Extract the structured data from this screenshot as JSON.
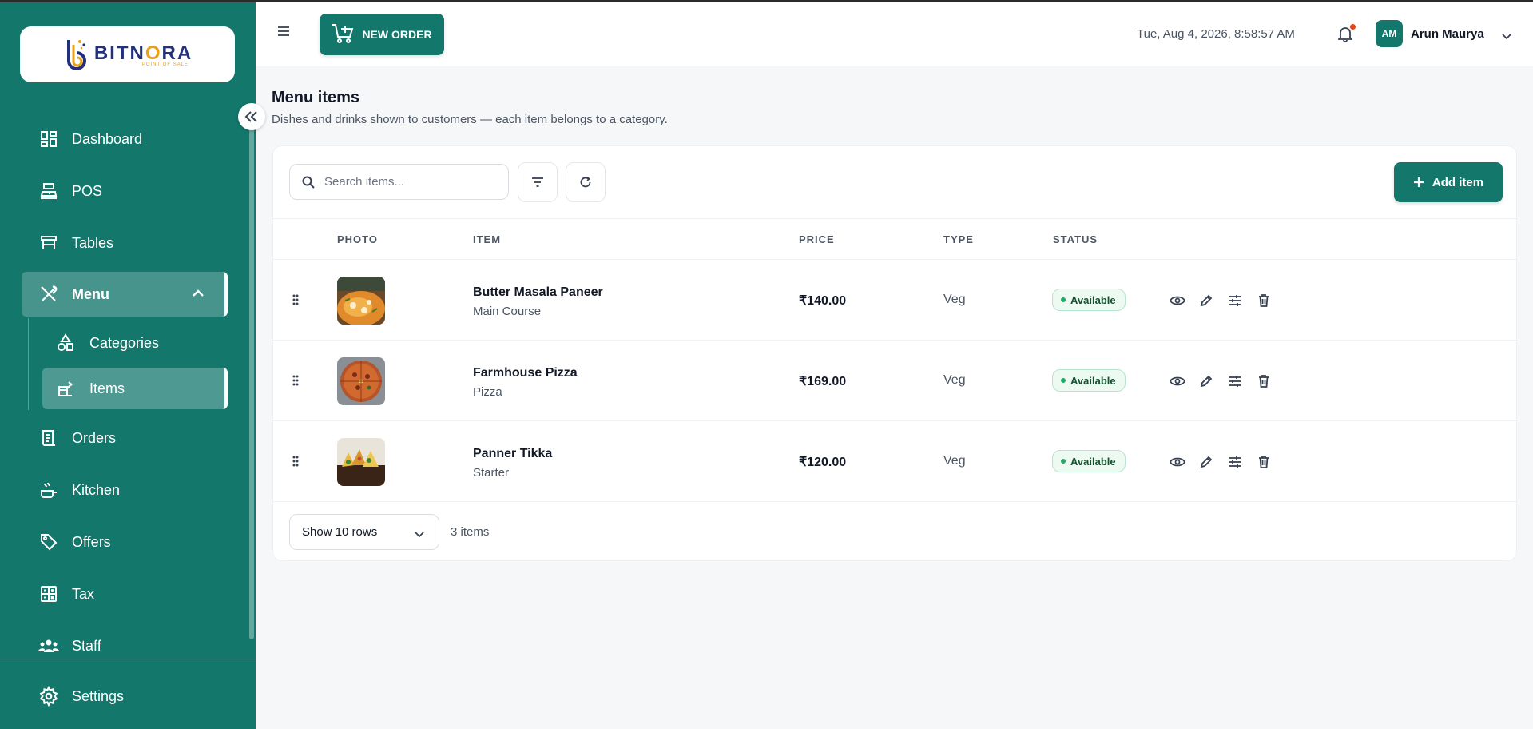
{
  "brand": {
    "name": "BITNORA",
    "tagline": "POINT OF SALE"
  },
  "sidebar": {
    "items": [
      {
        "label": "Dashboard",
        "icon": "dashboard-icon"
      },
      {
        "label": "POS",
        "icon": "cash-register-icon"
      },
      {
        "label": "Tables",
        "icon": "table-icon"
      },
      {
        "label": "Menu",
        "icon": "utensils-icon",
        "expanded": true
      },
      {
        "label": "Orders",
        "icon": "receipt-icon"
      },
      {
        "label": "Kitchen",
        "icon": "kitchen-icon"
      },
      {
        "label": "Offers",
        "icon": "tag-icon"
      },
      {
        "label": "Tax",
        "icon": "calculator-icon"
      },
      {
        "label": "Staff",
        "icon": "users-icon"
      }
    ],
    "submenu": [
      {
        "label": "Categories",
        "icon": "shapes-icon"
      },
      {
        "label": "Items",
        "icon": "food-tray-icon",
        "active": true
      }
    ],
    "settings_label": "Settings"
  },
  "header": {
    "new_order_label": "NEW ORDER",
    "datetime": "Tue, Aug 4, 2026, 8:58:57 AM",
    "user": {
      "initials": "AM",
      "name": "Arun Maurya"
    }
  },
  "page": {
    "title": "Menu items",
    "subtitle": "Dishes and drinks shown to customers — each item belongs to a category."
  },
  "toolbar": {
    "search_placeholder": "Search items...",
    "add_label": "Add item"
  },
  "table": {
    "columns": [
      "PHOTO",
      "ITEM",
      "PRICE",
      "TYPE",
      "STATUS"
    ],
    "rows": [
      {
        "name": "Butter Masala Paneer",
        "category": "Main Course",
        "price": "₹140.00",
        "type": "Veg",
        "status": "Available"
      },
      {
        "name": "Farmhouse Pizza",
        "category": "Pizza",
        "price": "₹169.00",
        "type": "Veg",
        "status": "Available"
      },
      {
        "name": "Panner Tikka",
        "category": "Starter",
        "price": "₹120.00",
        "type": "Veg",
        "status": "Available"
      }
    ]
  },
  "footer": {
    "rows_select": "Show 10 rows",
    "count": "3 items"
  },
  "colors": {
    "brand": "#13776c",
    "status_available": "#22a867",
    "notification_dot": "#e0461e"
  }
}
